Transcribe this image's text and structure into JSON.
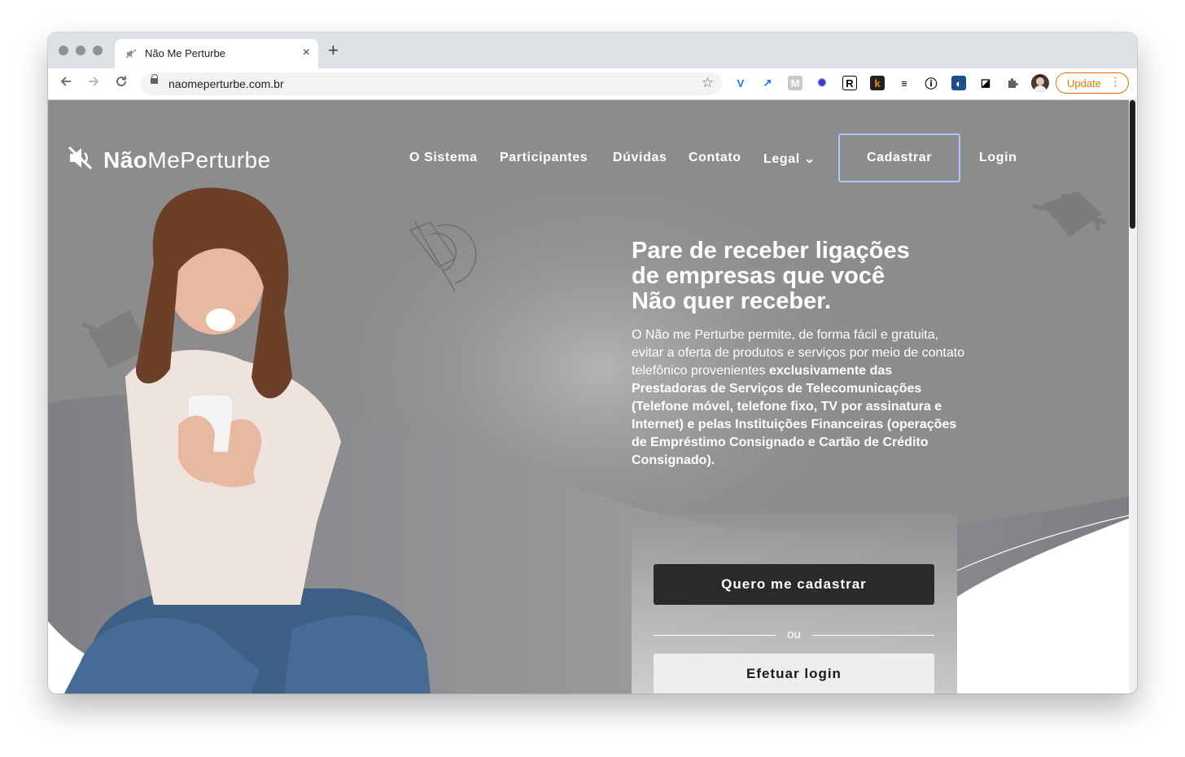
{
  "browser": {
    "tab_title": "Não Me Perturbe",
    "new_tab_symbol": "+",
    "close_symbol": "×",
    "url": "naomeperturbe.com.br",
    "update_label": "Update",
    "extensions": [
      "V",
      "↗",
      "M",
      "✺",
      "R",
      "k",
      "≡",
      "ⓘ",
      "◐",
      "◪",
      "✦"
    ]
  },
  "site": {
    "logo": {
      "bold": "Não",
      "regular": "MePerturbe"
    },
    "nav": {
      "items": [
        "O Sistema",
        "Participantes",
        "Dúvidas",
        "Contato",
        "Legal"
      ],
      "cadastrar_label": "Cadastrar",
      "login_label": "Login"
    },
    "hero": {
      "headline_1": "Pare de receber ligações",
      "headline_2": "de empresas que você",
      "headline_3": "Não quer receber.",
      "desc_regular": "O Não me Perturbe permite, de forma fácil e gratuita, evitar a oferta de produtos e serviços por meio de contato telefônico provenientes ",
      "desc_bold": "exclusivamente das Prestadoras de Serviços de Telecomunicações (Telefone móvel, telefone fixo, TV por assinatura e Internet) e pelas Instituições Financeiras (operações de Empréstimo Consignado e Cartão de Crédito Consignado)."
    },
    "card": {
      "primary_label": "Quero me cadastrar",
      "divider_label": "ou",
      "secondary_label": "Efetuar login"
    }
  },
  "colors": {
    "page_bg": "#8c8c8c",
    "accent_border": "#a8c7fa",
    "update_orange": "#e37400",
    "dark_button": "#2a2a2a"
  }
}
